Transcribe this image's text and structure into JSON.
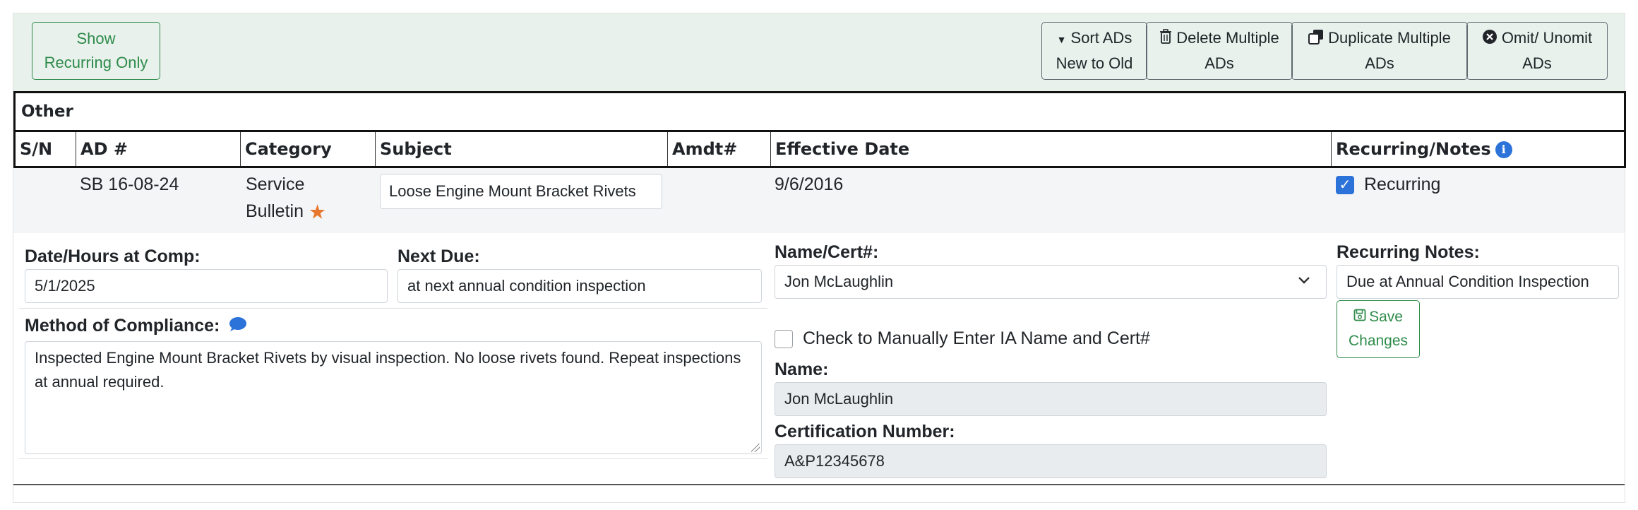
{
  "toolbar": {
    "show_recurring": "Show\nRecurring Only",
    "sort": {
      "line1": "Sort ADs",
      "line2": "New to Old"
    },
    "delete": {
      "line1": "Delete Multiple",
      "line2": "ADs"
    },
    "duplicate": {
      "line1": "Duplicate Multiple",
      "line2": "ADs"
    },
    "omit": {
      "line1": "Omit/ Unomit",
      "line2": "ADs"
    }
  },
  "section_title": "Other",
  "columns": [
    "S/N",
    "AD #",
    "Category",
    "Subject",
    "Amdt#",
    "Effective Date",
    "Recurring/Notes"
  ],
  "row": {
    "sn": "",
    "ad_number": "SB 16-08-24",
    "category_line1": "Service",
    "category_line2": "Bulletin",
    "subject": "Loose Engine Mount Bracket Rivets",
    "amdt": "",
    "effective_date": "9/6/2016",
    "recurring_label": "Recurring",
    "recurring_checked": true
  },
  "details": {
    "date_label": "Date/Hours at Comp:",
    "date_value": "5/1/2025",
    "next_due_label": "Next Due:",
    "next_due_value": "at next annual condition inspection",
    "method_label": "Method of Compliance:",
    "method_value": "Inspected Engine Mount Bracket Rivets by visual inspection. No loose rivets found. Repeat inspections at annual required.",
    "name_cert_label": "Name/Cert#:",
    "name_cert_value": "Jon McLaughlin",
    "manual_check_label": "Check to Manually Enter IA Name and Cert#",
    "name_label": "Name:",
    "name_value": "Jon McLaughlin",
    "cert_label": "Certification Number:",
    "cert_value": "A&P12345678",
    "recurring_notes_label": "Recurring Notes:",
    "recurring_notes_value": "Due at Annual Condition Inspection",
    "save_line1": "Save",
    "save_line2": "Changes"
  },
  "colors": {
    "accent_green": "#2e8b4a",
    "primary_blue": "#2b73d9",
    "star_orange": "#e8762d",
    "toolbar_bg": "#e8f1ec"
  },
  "icons": [
    "caret-down-icon",
    "trash-icon",
    "copy-icon",
    "x-circle-icon",
    "info-icon",
    "star-icon",
    "chat-icon",
    "chevron-down-icon",
    "save-icon",
    "checkbox-checked-icon"
  ]
}
